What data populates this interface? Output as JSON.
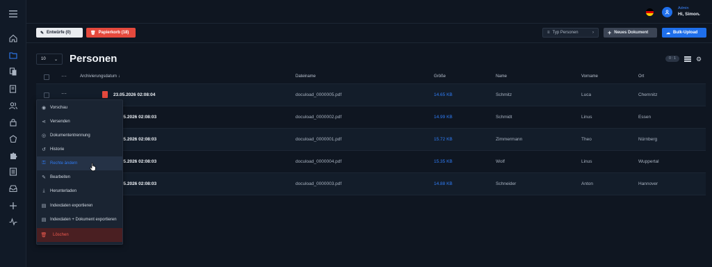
{
  "topbar": {
    "user_role": "Admin",
    "user_greeting": "Hi, Simon",
    "chevron": "⌄"
  },
  "toolbar": {
    "drafts_label": "Entwürfe (0)",
    "trash_label": "Papierkorb (18)",
    "type_filter_label": "Typ Personen",
    "new_document_label": "Neues Dokument",
    "bulk_upload_label": "Bulk-Upload"
  },
  "list": {
    "page_size": "10",
    "title": "Personen",
    "column_count_badge": "0 : 1"
  },
  "table": {
    "columns": [
      "Archivierungsdatum ↓",
      "Dateiname",
      "Größe",
      "Name",
      "Vorname",
      "Ort"
    ],
    "rows": [
      {
        "date": "23.05.2026 02:08:04",
        "date_visible": "23.05.2026 02:08:04",
        "file": "docuload_0000005.pdf",
        "size": "14.65 KB",
        "name": "Schmitz",
        "first": "Luca",
        "city": "Chemnitz"
      },
      {
        "date": "23.05.2026 02:08:03",
        "date_visible": ".05.2026 02:08:03",
        "file": "docuload_0000002.pdf",
        "size": "14.99 KB",
        "name": "Schmidt",
        "first": "Linus",
        "city": "Essen"
      },
      {
        "date": "23.05.2026 02:08:03",
        "date_visible": ".05.2026 02:08:03",
        "file": "docuload_0000001.pdf",
        "size": "15.72 KB",
        "name": "Zimmermann",
        "first": "Theo",
        "city": "Nürnberg"
      },
      {
        "date": "23.05.2026 02:08:03",
        "date_visible": ".05.2026 02:08:03",
        "file": "docuload_0000004.pdf",
        "size": "15.35 KB",
        "name": "Wolf",
        "first": "Linus",
        "city": "Wuppertal"
      },
      {
        "date": "23.05.2026 02:08:03",
        "date_visible": ".05.2026 02:08:03",
        "file": "docuload_0000003.pdf",
        "size": "14.88 KB",
        "name": "Schneider",
        "first": "Anton",
        "city": "Hannover"
      }
    ]
  },
  "context_menu": {
    "items": [
      {
        "label": "Vorschau",
        "icon": "eye-icon",
        "glyph": "◉"
      },
      {
        "label": "Versenden",
        "icon": "share-icon",
        "glyph": "⋖"
      },
      {
        "label": "Dokumententrennung",
        "icon": "split-icon",
        "glyph": "◎"
      },
      {
        "label": "Historie",
        "icon": "history-icon",
        "glyph": "↺"
      },
      {
        "label": "Rechte ändern",
        "icon": "lock-icon",
        "glyph": "⚿"
      },
      {
        "label": "Bearbeiten",
        "icon": "edit-icon",
        "glyph": "✎"
      },
      {
        "label": "Herunterladen",
        "icon": "download-icon",
        "glyph": "⤓"
      },
      {
        "label": "Indexdaten exportieren",
        "icon": "file-icon",
        "glyph": "▤"
      },
      {
        "label": "Indexdaten + Dokument exportieren",
        "icon": "file-icon",
        "glyph": "▤"
      },
      {
        "label": "Löschen",
        "icon": "trash-icon",
        "glyph": "🗑"
      }
    ]
  },
  "colors": {
    "accent": "#1f6feb",
    "danger": "#e5493d",
    "background": "#0f1621"
  }
}
